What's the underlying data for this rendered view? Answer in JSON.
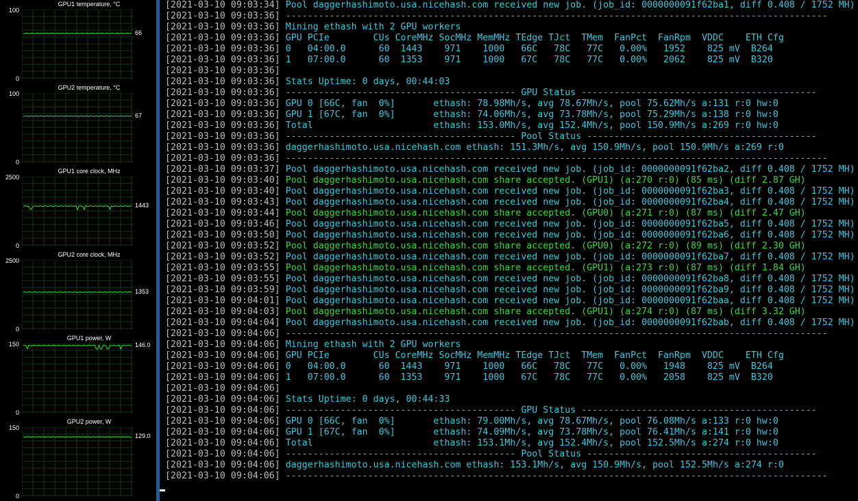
{
  "graphs": [
    {
      "title": "GPU1 temperature, °C",
      "max": "100",
      "min": "0",
      "current": "66",
      "level": 0.66,
      "dips": []
    },
    {
      "title": "GPU2 temperature, °C",
      "max": "100",
      "min": "0",
      "current": "67",
      "level": 0.67,
      "dips": []
    },
    {
      "title": "GPU1 core clock, MHz",
      "max": "2500",
      "min": "0",
      "current": "1443",
      "level": 0.577,
      "dips": [
        0.07,
        0.5,
        0.56,
        0.8
      ]
    },
    {
      "title": "GPU2 core clock, MHz",
      "max": "2500",
      "min": "0",
      "current": "1353",
      "level": 0.541,
      "dips": []
    },
    {
      "title": "GPU1 power, W",
      "max": "150",
      "min": "0",
      "current": "146.0",
      "level": 0.973,
      "dips": [
        0.04,
        0.68,
        0.72,
        0.78,
        0.9
      ]
    },
    {
      "title": "GPU2 power, W",
      "max": "150",
      "min": "0",
      "current": "129.0",
      "level": 0.86,
      "dips": []
    }
  ],
  "console": [
    {
      "ts": "[2021-03-10 09:03:34]",
      "msg": " Pool daggerhashimoto.usa.nicehash.com received new job. (job_id: 0000000091f62ba1, diff 0.408 / 1752 MH)",
      "color": "cyan"
    },
    {
      "ts": "[2021-03-10 09:03:36]",
      "msg": " ---------------------------------------------------------------------------------------------------",
      "color": "cyan"
    },
    {
      "ts": "[2021-03-10 09:03:36]",
      "msg": " Mining ethash with 2 GPU workers",
      "color": "cyan"
    },
    {
      "ts": "[2021-03-10 09:03:36]",
      "msg": " GPU PCIe        CUs CoreMHz SocMHz MemMHz TEdge TJct  TMem  FanPct  FanRpm  VDDC    ETH Cfg",
      "color": "cyan"
    },
    {
      "ts": "[2021-03-10 09:03:36]",
      "msg": " 0   04:00.0      60  1443    971    1000   66C   78C   77C   0.00%   1952    825 mV  B264",
      "color": "cyan"
    },
    {
      "ts": "[2021-03-10 09:03:36]",
      "msg": " 1   07:00.0      60  1353    971    1000   67C   78C   77C   0.00%   2062    825 mV  B320",
      "color": "cyan"
    },
    {
      "ts": "[2021-03-10 09:03:36]",
      "msg": "",
      "color": "cyan"
    },
    {
      "ts": "[2021-03-10 09:03:36]",
      "msg": " Stats Uptime: 0 days, 00:44:03",
      "color": "cyan"
    },
    {
      "ts": "[2021-03-10 09:03:36]",
      "msg": " ------------------------------------------ GPU Status -------------------------------------------",
      "color": "cyan"
    },
    {
      "ts": "[2021-03-10 09:03:36]",
      "msg": " GPU 0 [66C, fan  0%]       ethash: 78.98Mh/s, avg 78.67Mh/s, pool 75.62Mh/s a:131 r:0 hw:0",
      "color": "cyan"
    },
    {
      "ts": "[2021-03-10 09:03:36]",
      "msg": " GPU 1 [67C, fan  0%]       ethash: 74.06Mh/s, avg 73.78Mh/s, pool 75.29Mh/s a:138 r:0 hw:0",
      "color": "cyan"
    },
    {
      "ts": "[2021-03-10 09:03:36]",
      "msg": " Total                      ethash: 153.0Mh/s, avg 152.4Mh/s, pool 150.9Mh/s a:269 r:0 hw:0",
      "color": "cyan"
    },
    {
      "ts": "[2021-03-10 09:03:36]",
      "msg": " ------------------------------------------ Pool Status ------------------------------------------",
      "color": "cyan"
    },
    {
      "ts": "[2021-03-10 09:03:36]",
      "msg": " daggerhashimoto.usa.nicehash.com ethash: 151.3Mh/s, avg 150.9Mh/s, pool 150.9Mh/s a:269 r:0",
      "color": "cyan"
    },
    {
      "ts": "[2021-03-10 09:03:36]",
      "msg": " ---------------------------------------------------------------------------------------------------",
      "color": "cyan"
    },
    {
      "ts": "[2021-03-10 09:03:37]",
      "msg": " Pool daggerhashimoto.usa.nicehash.com received new job. (job_id: 0000000091f62ba2, diff 0.408 / 1752 MH)",
      "color": "cyan"
    },
    {
      "ts": "[2021-03-10 09:03:40]",
      "msg": " Pool daggerhashimoto.usa.nicehash.com share accepted. (GPU1) (a:270 r:0) (85 ms) (diff 2.87 GH)",
      "color": "green"
    },
    {
      "ts": "[2021-03-10 09:03:40]",
      "msg": " Pool daggerhashimoto.usa.nicehash.com received new job. (job_id: 0000000091f62ba3, diff 0.408 / 1752 MH)",
      "color": "cyan"
    },
    {
      "ts": "[2021-03-10 09:03:43]",
      "msg": " Pool daggerhashimoto.usa.nicehash.com received new job. (job_id: 0000000091f62ba4, diff 0.408 / 1752 MH)",
      "color": "cyan"
    },
    {
      "ts": "[2021-03-10 09:03:44]",
      "msg": " Pool daggerhashimoto.usa.nicehash.com share accepted. (GPU0) (a:271 r:0) (87 ms) (diff 2.47 GH)",
      "color": "green"
    },
    {
      "ts": "[2021-03-10 09:03:46]",
      "msg": " Pool daggerhashimoto.usa.nicehash.com received new job. (job_id: 0000000091f62ba5, diff 0.408 / 1752 MH)",
      "color": "cyan"
    },
    {
      "ts": "[2021-03-10 09:03:50]",
      "msg": " Pool daggerhashimoto.usa.nicehash.com received new job. (job_id: 0000000091f62ba6, diff 0.408 / 1752 MH)",
      "color": "cyan"
    },
    {
      "ts": "[2021-03-10 09:03:52]",
      "msg": " Pool daggerhashimoto.usa.nicehash.com share accepted. (GPU0) (a:272 r:0) (89 ms) (diff 2.30 GH)",
      "color": "green"
    },
    {
      "ts": "[2021-03-10 09:03:52]",
      "msg": " Pool daggerhashimoto.usa.nicehash.com received new job. (job_id: 0000000091f62ba7, diff 0.408 / 1752 MH)",
      "color": "cyan"
    },
    {
      "ts": "[2021-03-10 09:03:55]",
      "msg": " Pool daggerhashimoto.usa.nicehash.com share accepted. (GPU1) (a:273 r:0) (87 ms) (diff 1.84 GH)",
      "color": "green"
    },
    {
      "ts": "[2021-03-10 09:03:55]",
      "msg": " Pool daggerhashimoto.usa.nicehash.com received new job. (job_id: 0000000091f62ba8, diff 0.408 / 1752 MH)",
      "color": "cyan"
    },
    {
      "ts": "[2021-03-10 09:03:59]",
      "msg": " Pool daggerhashimoto.usa.nicehash.com received new job. (job_id: 0000000091f62ba9, diff 0.408 / 1752 MH)",
      "color": "cyan"
    },
    {
      "ts": "[2021-03-10 09:04:01]",
      "msg": " Pool daggerhashimoto.usa.nicehash.com received new job. (job_id: 0000000091f62baa, diff 0.408 / 1752 MH)",
      "color": "cyan"
    },
    {
      "ts": "[2021-03-10 09:04:03]",
      "msg": " Pool daggerhashimoto.usa.nicehash.com share accepted. (GPU1) (a:274 r:0) (87 ms) (diff 3.32 GH)",
      "color": "green"
    },
    {
      "ts": "[2021-03-10 09:04:04]",
      "msg": " Pool daggerhashimoto.usa.nicehash.com received new job. (job_id: 0000000091f62bab, diff 0.408 / 1752 MH)",
      "color": "cyan"
    },
    {
      "ts": "[2021-03-10 09:04:06]",
      "msg": " ---------------------------------------------------------------------------------------------------",
      "color": "cyan"
    },
    {
      "ts": "[2021-03-10 09:04:06]",
      "msg": " Mining ethash with 2 GPU workers",
      "color": "cyan"
    },
    {
      "ts": "[2021-03-10 09:04:06]",
      "msg": " GPU PCIe        CUs CoreMHz SocMHz MemMHz TEdge TJct  TMem  FanPct  FanRpm  VDDC    ETH Cfg",
      "color": "cyan"
    },
    {
      "ts": "[2021-03-10 09:04:06]",
      "msg": " 0   04:00.0      60  1443    971    1000   66C   78C   77C   0.00%   1948    825 mV  B264",
      "color": "cyan"
    },
    {
      "ts": "[2021-03-10 09:04:06]",
      "msg": " 1   07:00.0      60  1353    971    1000   67C   78C   77C   0.00%   2058    825 mV  B320",
      "color": "cyan"
    },
    {
      "ts": "[2021-03-10 09:04:06]",
      "msg": "",
      "color": "cyan"
    },
    {
      "ts": "[2021-03-10 09:04:06]",
      "msg": " Stats Uptime: 0 days, 00:44:33",
      "color": "cyan"
    },
    {
      "ts": "[2021-03-10 09:04:06]",
      "msg": " ------------------------------------------ GPU Status -------------------------------------------",
      "color": "cyan"
    },
    {
      "ts": "[2021-03-10 09:04:06]",
      "msg": " GPU 0 [66C, fan  0%]       ethash: 79.00Mh/s, avg 78.67Mh/s, pool 76.08Mh/s a:133 r:0 hw:0",
      "color": "cyan"
    },
    {
      "ts": "[2021-03-10 09:04:06]",
      "msg": " GPU 1 [67C, fan  0%]       ethash: 74.09Mh/s, avg 73.78Mh/s, pool 76.41Mh/s a:141 r:0 hw:0",
      "color": "cyan"
    },
    {
      "ts": "[2021-03-10 09:04:06]",
      "msg": " Total                      ethash: 153.1Mh/s, avg 152.4Mh/s, pool 152.5Mh/s a:274 r:0 hw:0",
      "color": "cyan"
    },
    {
      "ts": "[2021-03-10 09:04:06]",
      "msg": " ------------------------------------------ Pool Status ------------------------------------------",
      "color": "cyan"
    },
    {
      "ts": "[2021-03-10 09:04:06]",
      "msg": " daggerhashimoto.usa.nicehash.com ethash: 153.1Mh/s, avg 150.9Mh/s, pool 152.5Mh/s a:274 r:0",
      "color": "cyan"
    },
    {
      "ts": "[2021-03-10 09:04:06]",
      "msg": " ---------------------------------------------------------------------------------------------------",
      "color": "cyan"
    }
  ]
}
